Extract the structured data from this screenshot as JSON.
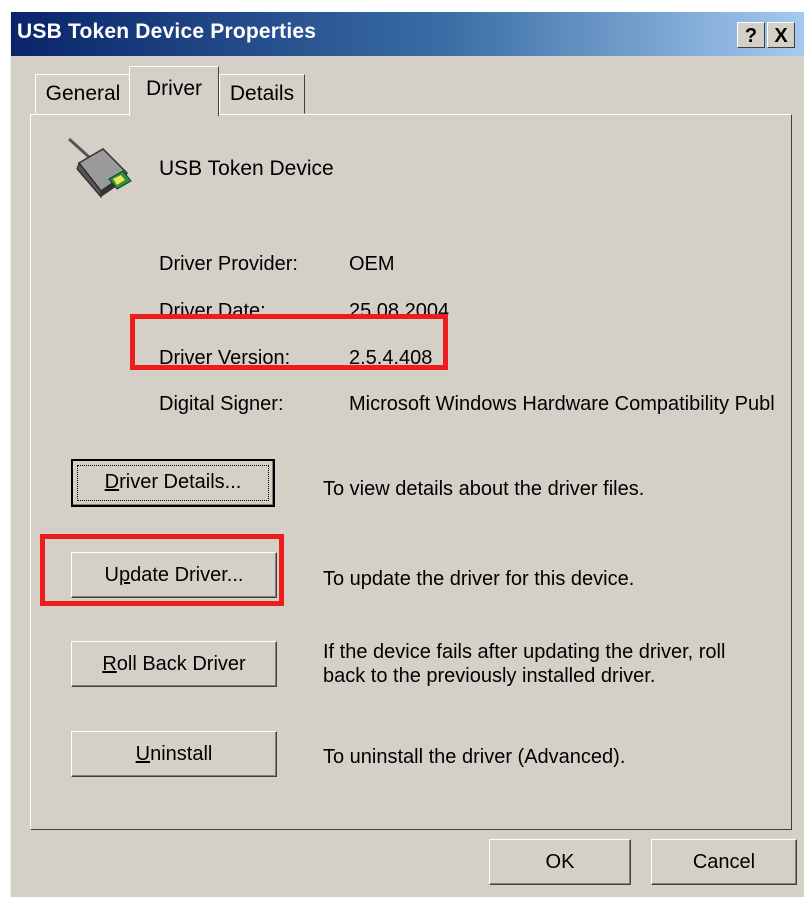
{
  "window": {
    "title": "USB Token Device Properties",
    "help_label": "?",
    "close_label": "X"
  },
  "tabs": [
    {
      "label": "General"
    },
    {
      "label": "Driver"
    },
    {
      "label": "Details"
    }
  ],
  "device": {
    "name": "USB Token Device",
    "icon": "usb-token-icon"
  },
  "info": {
    "provider_label": "Driver Provider:",
    "provider_value": "OEM",
    "date_label": "Driver Date:",
    "date_value": "25.08.2004",
    "version_label": "Driver Version:",
    "version_value": "2.5.4.408",
    "signer_label": "Digital Signer:",
    "signer_value": "Microsoft Windows Hardware Compatibility Publ"
  },
  "actions": {
    "details_pre": "",
    "details_accel": "D",
    "details_post": "river Details...",
    "details_desc": "To view details about the driver files.",
    "update_pre": "U",
    "update_accel": "p",
    "update_post": "date Driver...",
    "update_desc": "To update the driver for this device.",
    "rollback_pre": "",
    "rollback_accel": "R",
    "rollback_post": "oll Back Driver",
    "rollback_desc_1": "If the device fails after updating the driver, roll",
    "rollback_desc_2": "back to the previously installed driver.",
    "uninstall_pre": "",
    "uninstall_accel": "U",
    "uninstall_post": "ninstall",
    "uninstall_desc": "To uninstall the driver (Advanced)."
  },
  "footer": {
    "ok_label": "OK",
    "cancel_label": "Cancel"
  },
  "colors": {
    "highlight": "#ee1c1c",
    "face": "#d4d0c8",
    "title_start": "#0a246a"
  }
}
